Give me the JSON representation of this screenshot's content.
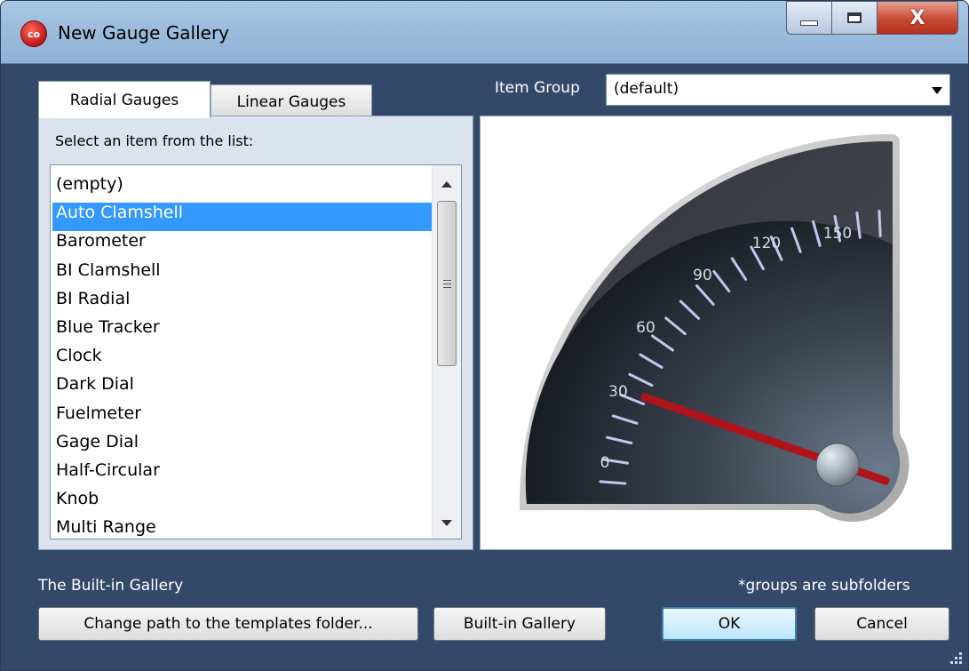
{
  "window": {
    "title": "New Gauge Gallery",
    "app_icon_text": "co",
    "controls": {
      "minimize": "minimize-icon",
      "maximize": "maximize-icon",
      "close": "X"
    }
  },
  "tabs": [
    {
      "label": "Radial Gauges",
      "active": true
    },
    {
      "label": "Linear Gauges",
      "active": false
    }
  ],
  "item_group": {
    "label": "Item Group",
    "value": "(default)"
  },
  "list": {
    "prompt": "Select an item from the list:",
    "selected_index": 1,
    "items": [
      "(empty)",
      "Auto Clamshell",
      "Barometer",
      "BI Clamshell",
      "BI Radial",
      "Blue Tracker",
      "Clock",
      "Dark Dial",
      "Fuelmeter",
      "Gage Dial",
      "Half-Circular",
      "Knob",
      "Multi Range"
    ]
  },
  "preview": {
    "gauge_labels": [
      "0",
      "30",
      "60",
      "90",
      "120",
      "150"
    ],
    "needle_value": 30,
    "scale_min": 0,
    "scale_max": 150,
    "colors": {
      "needle": "#b0141b",
      "ticks": "#c9c3ee",
      "label": "#d6dde6"
    }
  },
  "footer": {
    "gallery_label": "The Built-in Gallery",
    "groups_note": "*groups are subfolders",
    "buttons": {
      "change_path": "Change path to the templates folder...",
      "builtin": "Built-in Gallery",
      "ok": "OK",
      "cancel": "Cancel"
    }
  }
}
